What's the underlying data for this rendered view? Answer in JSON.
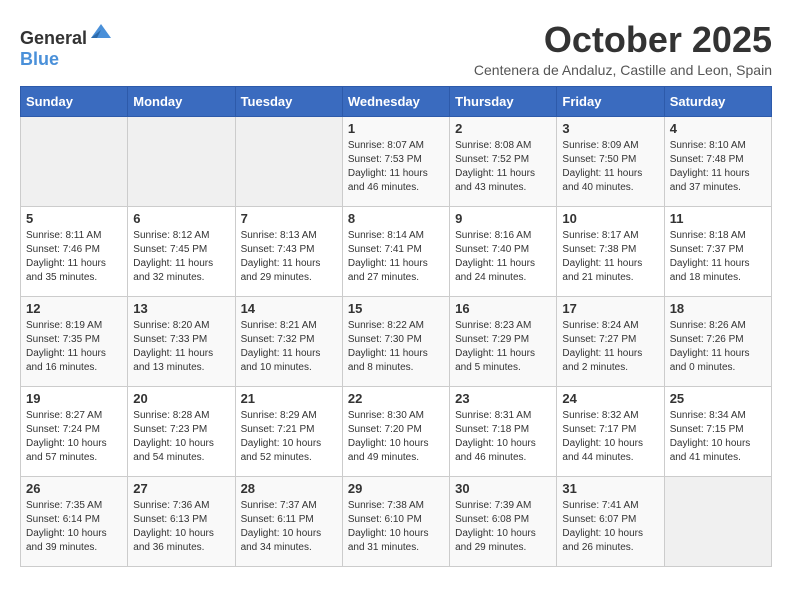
{
  "header": {
    "logo_general": "General",
    "logo_blue": "Blue",
    "month_title": "October 2025",
    "location": "Centenera de Andaluz, Castille and Leon, Spain"
  },
  "weekdays": [
    "Sunday",
    "Monday",
    "Tuesday",
    "Wednesday",
    "Thursday",
    "Friday",
    "Saturday"
  ],
  "weeks": [
    [
      {
        "day": "",
        "sunrise": "",
        "sunset": "",
        "daylight": ""
      },
      {
        "day": "",
        "sunrise": "",
        "sunset": "",
        "daylight": ""
      },
      {
        "day": "",
        "sunrise": "",
        "sunset": "",
        "daylight": ""
      },
      {
        "day": "1",
        "sunrise": "Sunrise: 8:07 AM",
        "sunset": "Sunset: 7:53 PM",
        "daylight": "Daylight: 11 hours and 46 minutes."
      },
      {
        "day": "2",
        "sunrise": "Sunrise: 8:08 AM",
        "sunset": "Sunset: 7:52 PM",
        "daylight": "Daylight: 11 hours and 43 minutes."
      },
      {
        "day": "3",
        "sunrise": "Sunrise: 8:09 AM",
        "sunset": "Sunset: 7:50 PM",
        "daylight": "Daylight: 11 hours and 40 minutes."
      },
      {
        "day": "4",
        "sunrise": "Sunrise: 8:10 AM",
        "sunset": "Sunset: 7:48 PM",
        "daylight": "Daylight: 11 hours and 37 minutes."
      }
    ],
    [
      {
        "day": "5",
        "sunrise": "Sunrise: 8:11 AM",
        "sunset": "Sunset: 7:46 PM",
        "daylight": "Daylight: 11 hours and 35 minutes."
      },
      {
        "day": "6",
        "sunrise": "Sunrise: 8:12 AM",
        "sunset": "Sunset: 7:45 PM",
        "daylight": "Daylight: 11 hours and 32 minutes."
      },
      {
        "day": "7",
        "sunrise": "Sunrise: 8:13 AM",
        "sunset": "Sunset: 7:43 PM",
        "daylight": "Daylight: 11 hours and 29 minutes."
      },
      {
        "day": "8",
        "sunrise": "Sunrise: 8:14 AM",
        "sunset": "Sunset: 7:41 PM",
        "daylight": "Daylight: 11 hours and 27 minutes."
      },
      {
        "day": "9",
        "sunrise": "Sunrise: 8:16 AM",
        "sunset": "Sunset: 7:40 PM",
        "daylight": "Daylight: 11 hours and 24 minutes."
      },
      {
        "day": "10",
        "sunrise": "Sunrise: 8:17 AM",
        "sunset": "Sunset: 7:38 PM",
        "daylight": "Daylight: 11 hours and 21 minutes."
      },
      {
        "day": "11",
        "sunrise": "Sunrise: 8:18 AM",
        "sunset": "Sunset: 7:37 PM",
        "daylight": "Daylight: 11 hours and 18 minutes."
      }
    ],
    [
      {
        "day": "12",
        "sunrise": "Sunrise: 8:19 AM",
        "sunset": "Sunset: 7:35 PM",
        "daylight": "Daylight: 11 hours and 16 minutes."
      },
      {
        "day": "13",
        "sunrise": "Sunrise: 8:20 AM",
        "sunset": "Sunset: 7:33 PM",
        "daylight": "Daylight: 11 hours and 13 minutes."
      },
      {
        "day": "14",
        "sunrise": "Sunrise: 8:21 AM",
        "sunset": "Sunset: 7:32 PM",
        "daylight": "Daylight: 11 hours and 10 minutes."
      },
      {
        "day": "15",
        "sunrise": "Sunrise: 8:22 AM",
        "sunset": "Sunset: 7:30 PM",
        "daylight": "Daylight: 11 hours and 8 minutes."
      },
      {
        "day": "16",
        "sunrise": "Sunrise: 8:23 AM",
        "sunset": "Sunset: 7:29 PM",
        "daylight": "Daylight: 11 hours and 5 minutes."
      },
      {
        "day": "17",
        "sunrise": "Sunrise: 8:24 AM",
        "sunset": "Sunset: 7:27 PM",
        "daylight": "Daylight: 11 hours and 2 minutes."
      },
      {
        "day": "18",
        "sunrise": "Sunrise: 8:26 AM",
        "sunset": "Sunset: 7:26 PM",
        "daylight": "Daylight: 11 hours and 0 minutes."
      }
    ],
    [
      {
        "day": "19",
        "sunrise": "Sunrise: 8:27 AM",
        "sunset": "Sunset: 7:24 PM",
        "daylight": "Daylight: 10 hours and 57 minutes."
      },
      {
        "day": "20",
        "sunrise": "Sunrise: 8:28 AM",
        "sunset": "Sunset: 7:23 PM",
        "daylight": "Daylight: 10 hours and 54 minutes."
      },
      {
        "day": "21",
        "sunrise": "Sunrise: 8:29 AM",
        "sunset": "Sunset: 7:21 PM",
        "daylight": "Daylight: 10 hours and 52 minutes."
      },
      {
        "day": "22",
        "sunrise": "Sunrise: 8:30 AM",
        "sunset": "Sunset: 7:20 PM",
        "daylight": "Daylight: 10 hours and 49 minutes."
      },
      {
        "day": "23",
        "sunrise": "Sunrise: 8:31 AM",
        "sunset": "Sunset: 7:18 PM",
        "daylight": "Daylight: 10 hours and 46 minutes."
      },
      {
        "day": "24",
        "sunrise": "Sunrise: 8:32 AM",
        "sunset": "Sunset: 7:17 PM",
        "daylight": "Daylight: 10 hours and 44 minutes."
      },
      {
        "day": "25",
        "sunrise": "Sunrise: 8:34 AM",
        "sunset": "Sunset: 7:15 PM",
        "daylight": "Daylight: 10 hours and 41 minutes."
      }
    ],
    [
      {
        "day": "26",
        "sunrise": "Sunrise: 7:35 AM",
        "sunset": "Sunset: 6:14 PM",
        "daylight": "Daylight: 10 hours and 39 minutes."
      },
      {
        "day": "27",
        "sunrise": "Sunrise: 7:36 AM",
        "sunset": "Sunset: 6:13 PM",
        "daylight": "Daylight: 10 hours and 36 minutes."
      },
      {
        "day": "28",
        "sunrise": "Sunrise: 7:37 AM",
        "sunset": "Sunset: 6:11 PM",
        "daylight": "Daylight: 10 hours and 34 minutes."
      },
      {
        "day": "29",
        "sunrise": "Sunrise: 7:38 AM",
        "sunset": "Sunset: 6:10 PM",
        "daylight": "Daylight: 10 hours and 31 minutes."
      },
      {
        "day": "30",
        "sunrise": "Sunrise: 7:39 AM",
        "sunset": "Sunset: 6:08 PM",
        "daylight": "Daylight: 10 hours and 29 minutes."
      },
      {
        "day": "31",
        "sunrise": "Sunrise: 7:41 AM",
        "sunset": "Sunset: 6:07 PM",
        "daylight": "Daylight: 10 hours and 26 minutes."
      },
      {
        "day": "",
        "sunrise": "",
        "sunset": "",
        "daylight": ""
      }
    ]
  ]
}
